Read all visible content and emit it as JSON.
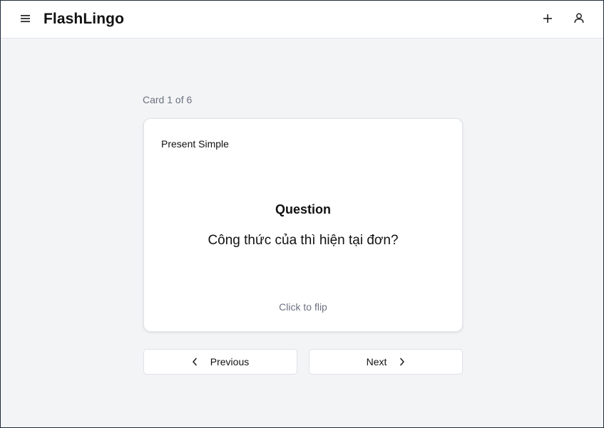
{
  "header": {
    "brand": "FlashLingo",
    "icons": {
      "menu": "menu-icon",
      "add": "plus-icon",
      "account": "user-icon"
    }
  },
  "study": {
    "counter": "Card 1 of 6",
    "card": {
      "tag": "Present Simple",
      "heading": "Question",
      "text": "Công thức của thì hiện tại đơn?",
      "hint": "Click to flip"
    },
    "nav": {
      "previous_label": "Previous",
      "next_label": "Next"
    }
  },
  "colors": {
    "background": "#f3f4f6",
    "surface": "#ffffff",
    "muted_text": "#6b7280",
    "border": "#e2e4e8"
  }
}
